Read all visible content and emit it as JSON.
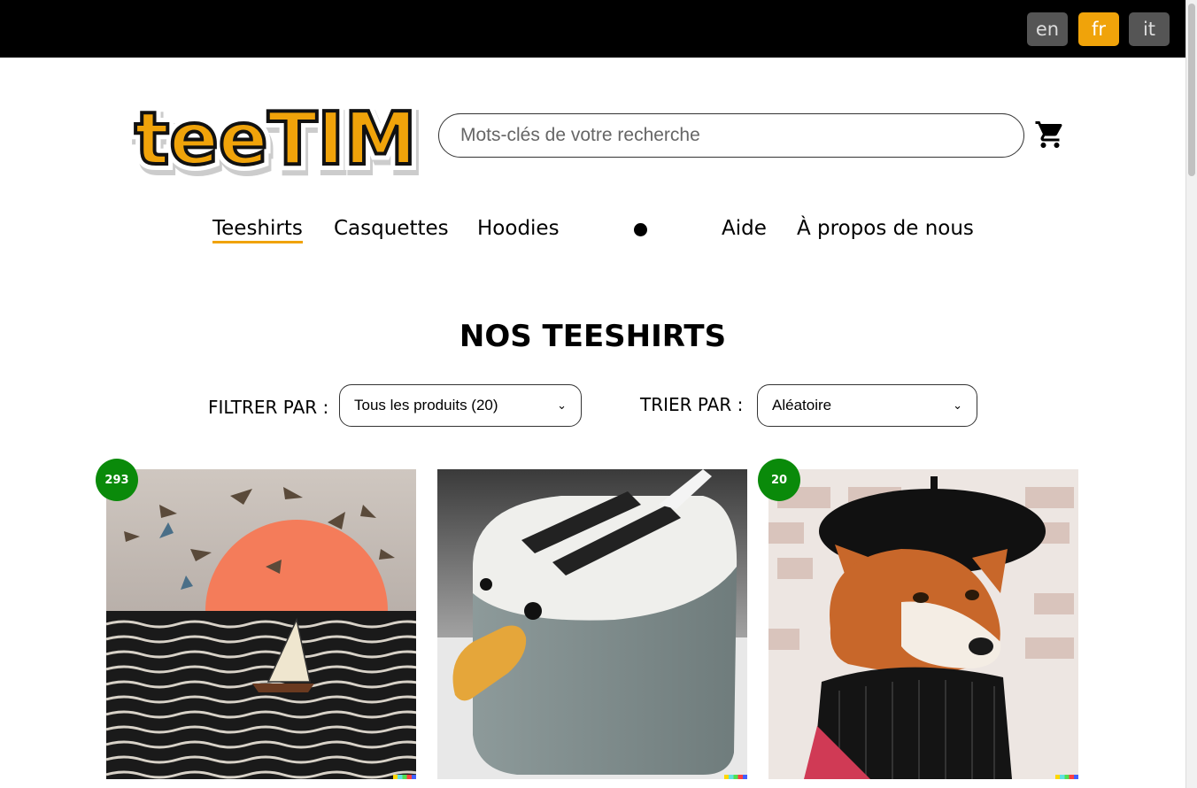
{
  "languages": [
    {
      "label": "en",
      "active": false
    },
    {
      "label": "fr",
      "active": true
    },
    {
      "label": "it",
      "active": false
    }
  ],
  "brand": {
    "logo_text": "teeTIM"
  },
  "search": {
    "placeholder": "Mots-clés de votre recherche"
  },
  "nav": {
    "items": [
      "Teeshirts",
      "Casquettes",
      "Hoodies",
      "Aide",
      "À propos de nous"
    ],
    "active": "Teeshirts"
  },
  "page": {
    "title": "NOS TEESHIRTS"
  },
  "filters": {
    "filter_label": "FILTRER PAR :",
    "filter_value": "Tous les produits (20)",
    "sort_label": "TRIER PAR :",
    "sort_value": "Aléatoire"
  },
  "products": [
    {
      "badge": "293",
      "image": "sailboat-sunset-birds"
    },
    {
      "badge": "",
      "image": "duck-toaster"
    },
    {
      "badge": "20",
      "image": "shiba-beret-dog"
    }
  ],
  "colors": {
    "accent": "#f0a30a",
    "badge": "#0a8a0a",
    "topbar": "#000000"
  }
}
